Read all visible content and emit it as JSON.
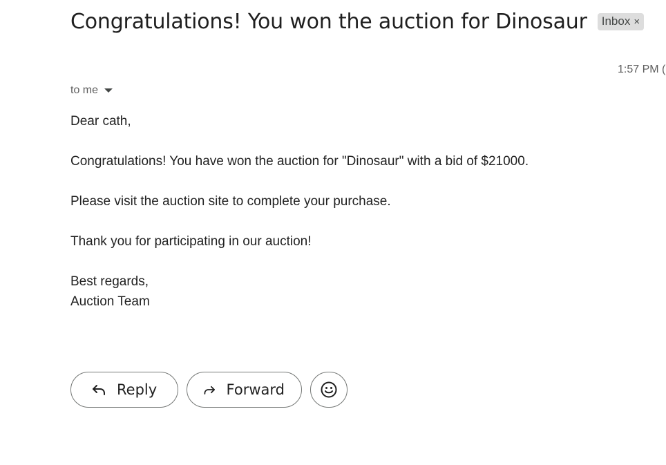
{
  "email": {
    "subject": "Congratulations! You won the auction for Dinosaur",
    "label": "Inbox",
    "label_close_glyph": "×",
    "timestamp": "1:57 PM (",
    "recipient": "to me",
    "body_lines": [
      "Dear cath,",
      "Congratulations! You have won the auction for \"Dinosaur\" with a bid of $21000.",
      "Please visit the auction site to complete your purchase.",
      "Thank you for participating in our auction!",
      "Best regards,",
      "Auction Team"
    ]
  },
  "actions": {
    "reply_label": "Reply",
    "forward_label": "Forward",
    "reply_icon": "reply-arrow-icon",
    "forward_icon": "forward-arrow-icon",
    "emoji_icon": "smiley-face-icon"
  }
}
